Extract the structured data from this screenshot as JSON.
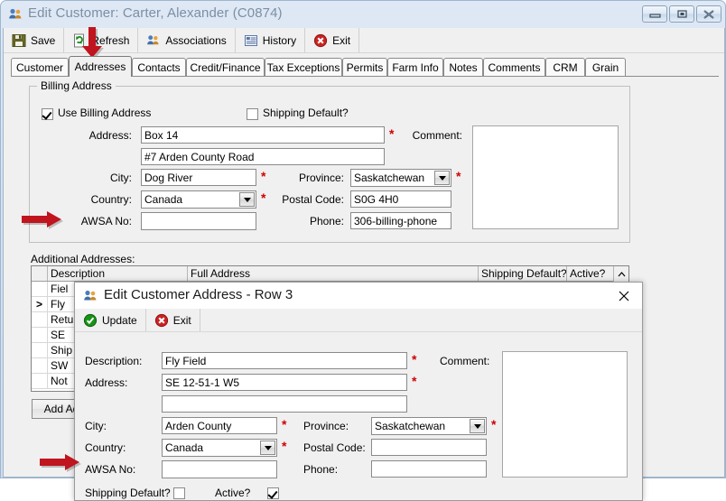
{
  "window": {
    "title": "Edit Customer: Carter, Alexander (C0874)",
    "icon": "customers-icon",
    "controls": {
      "minimize": "minimize-icon",
      "maximize": "maximize-icon",
      "close": "close-icon"
    }
  },
  "toolbar": {
    "items": [
      {
        "label": "Save",
        "icon": "save-disk-icon"
      },
      {
        "label": "Refresh",
        "icon": "refresh-icon"
      },
      {
        "label": "Associations",
        "icon": "associations-icon"
      },
      {
        "label": "History",
        "icon": "history-icon"
      },
      {
        "label": "Exit",
        "icon": "exit-icon"
      }
    ]
  },
  "tabs": {
    "active": "Addresses",
    "items": [
      "Customer",
      "Addresses",
      "Contacts",
      "Credit/Finance",
      "Tax Exceptions",
      "Permits",
      "Farm Info",
      "Notes",
      "Comments",
      "CRM",
      "Grain"
    ]
  },
  "billing": {
    "group_title": "Billing Address",
    "use_billing_label": "Use Billing Address",
    "use_billing_checked": true,
    "shipping_default_label": "Shipping Default?",
    "shipping_default_checked": false,
    "address_label": "Address:",
    "address_line1": "Box 14",
    "address_line2": "#7 Arden County Road",
    "city_label": "City:",
    "city": "Dog River",
    "country_label": "Country:",
    "country": "Canada",
    "awsa_label": "AWSA No:",
    "awsa": "",
    "province_label": "Province:",
    "province": "Saskatchewan",
    "postal_label": "Postal Code:",
    "postal": "S0G 4H0",
    "phone_label": "Phone:",
    "phone": "306-billing-phone",
    "comment_label": "Comment:",
    "comment": ""
  },
  "additional": {
    "section_label": "Additional Addresses:",
    "columns": [
      "",
      "Description",
      "Full Address",
      "Shipping Default?",
      "Active?"
    ],
    "rows": [
      {
        "indicator": "",
        "description": "Fiel",
        "full_address": ""
      },
      {
        "indicator": ">",
        "description": "Fly",
        "full_address": ""
      },
      {
        "indicator": "",
        "description": "Retu",
        "full_address": ""
      },
      {
        "indicator": "",
        "description": "SE ",
        "full_address": ""
      },
      {
        "indicator": "",
        "description": "Ship",
        "full_address": ""
      },
      {
        "indicator": "",
        "description": "SW",
        "full_address": ""
      },
      {
        "indicator": "",
        "description": "Not",
        "full_address": ""
      }
    ],
    "scroll_up_icon": "chevron-up-icon",
    "add_button": "Add Ad"
  },
  "dialog": {
    "title": "Edit Customer Address - Row 3",
    "icon": "customers-icon",
    "close_icon": "close-icon",
    "toolbar": [
      {
        "label": "Update",
        "icon": "check-circle-icon"
      },
      {
        "label": "Exit",
        "icon": "exit-icon"
      }
    ],
    "description_label": "Description:",
    "description": "Fly Field",
    "address_label": "Address:",
    "address_line1": "SE 12-51-1 W5",
    "address_line2": "",
    "city_label": "City:",
    "city": "Arden County",
    "country_label": "Country:",
    "country": "Canada",
    "awsa_label": "AWSA No:",
    "awsa": "",
    "province_label": "Province:",
    "province": "Saskatchewan",
    "postal_label": "Postal Code:",
    "postal": "",
    "phone_label": "Phone:",
    "phone": "",
    "comment_label": "Comment:",
    "comment": "",
    "shipping_default_label": "Shipping Default?",
    "shipping_default_checked": false,
    "active_label": "Active?",
    "active_checked": true
  },
  "annotations": {
    "arrow_color": "#c0141e",
    "arrow_tab": "arrow-pointing-to-addresses-tab",
    "arrow_billing_awsa": "arrow-pointing-to-billing-awsa-field",
    "arrow_dialog_awsa": "arrow-pointing-to-dialog-awsa-field"
  },
  "colors": {
    "required_marker": "#d00000",
    "window_chrome": "#d4e0f0",
    "client_bg": "#f0f0f0"
  }
}
